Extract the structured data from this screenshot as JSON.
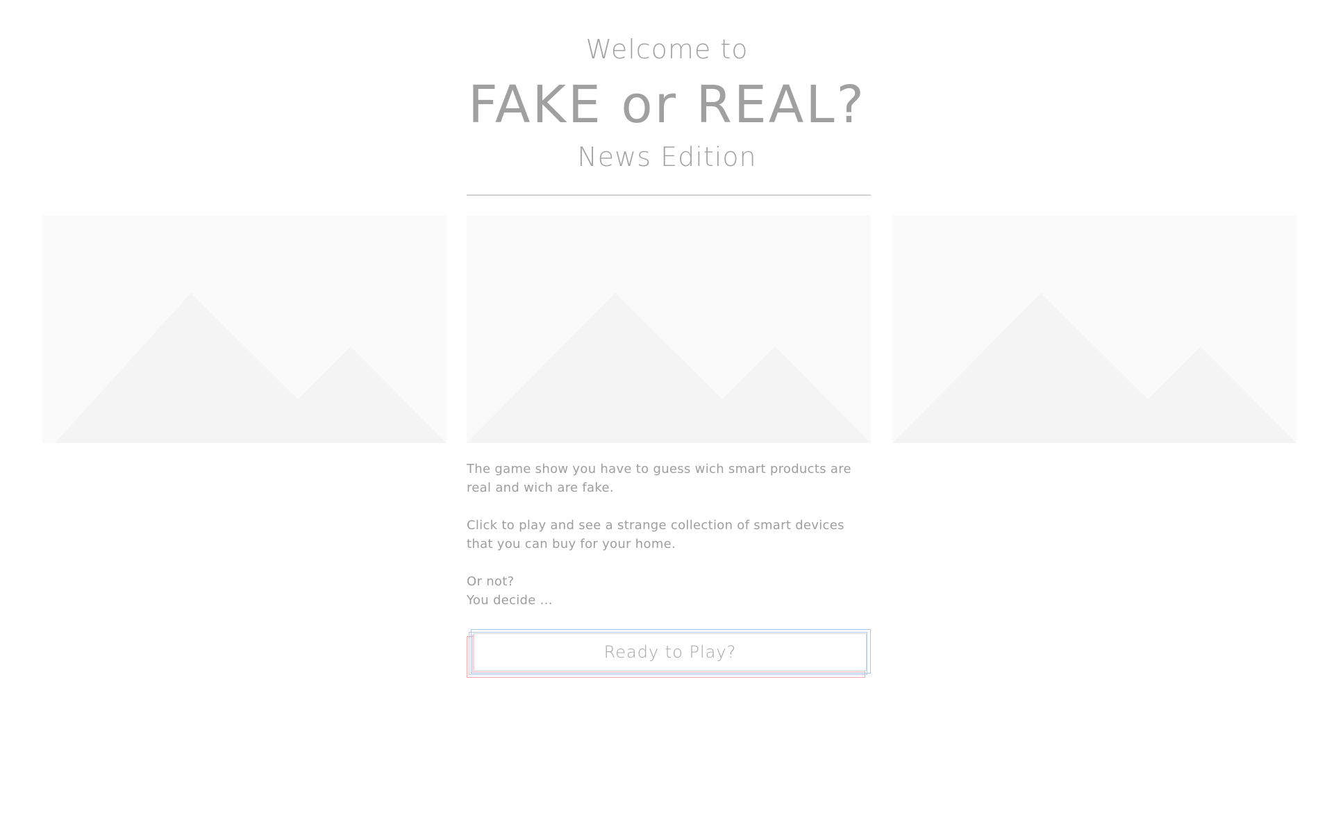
{
  "header": {
    "welcome": "Welcome to",
    "title": "FAKE or REAL?",
    "edition": "News Edition"
  },
  "images": [
    {
      "icon": "image-placeholder-icon"
    },
    {
      "icon": "image-placeholder-icon"
    },
    {
      "icon": "image-placeholder-icon"
    }
  ],
  "description": {
    "paragraph_1": "The game show you have to guess wich smart products are real and wich are fake.",
    "paragraph_2": "Click to play and see a strange collection of smart devices that you can buy for your home.",
    "line_3a": "Or not?",
    "line_3b": "You decide ..."
  },
  "play_button": {
    "label": "Ready to Play?"
  },
  "colors": {
    "text": "#9a9a9a",
    "placeholder_bg": "#fafafa",
    "placeholder_shape": "#f4f4f4",
    "divider": "#d2d2d2",
    "frame_red": "#f2a7b0",
    "frame_blue": "#a9c4e8"
  }
}
